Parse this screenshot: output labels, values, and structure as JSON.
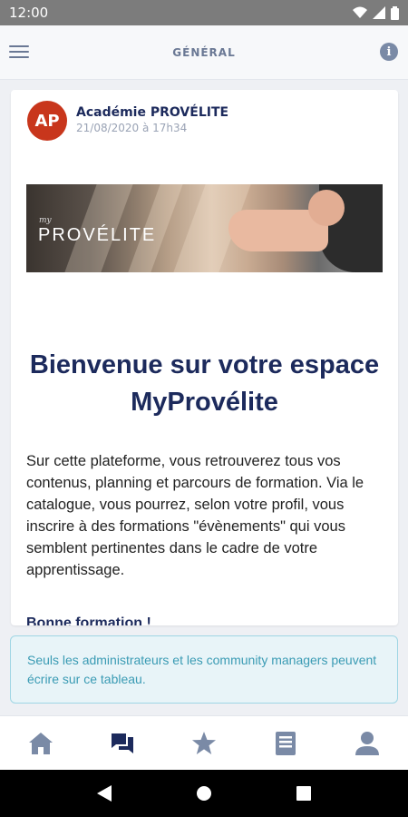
{
  "status_bar": {
    "time": "12:00"
  },
  "header": {
    "title": "GÉNÉRAL"
  },
  "post": {
    "avatar_initials": "AP",
    "author": "Académie PROVÉLITE",
    "date": "21/08/2020 à 17h34",
    "banner": {
      "logo_prefix": "my",
      "logo": "PROVÉLITE"
    },
    "headline": "Bienvenue sur votre espace MyProvélite",
    "body": "Sur cette plateforme, vous retrouverez tous vos contenus, planning et parcours de formation. Via le catalogue, vous pourrez, selon votre profil, vous inscrire à des formations \"évènements\" qui vous semblent pertinentes dans le cadre de votre apprentissage.",
    "signoff": "Bonne formation !"
  },
  "notice": {
    "text": "Seuls les administrateurs et les community managers peuvent écrire sur ce tableau."
  },
  "bottom_nav": {
    "items": [
      {
        "icon": "home-icon",
        "active": false
      },
      {
        "icon": "chat-icon",
        "active": true
      },
      {
        "icon": "star-icon",
        "active": false
      },
      {
        "icon": "book-icon",
        "active": false
      },
      {
        "icon": "profile-icon",
        "active": false
      }
    ]
  },
  "colors": {
    "primary": "#1c2a5c",
    "accent_avatar": "#c8361c",
    "nav_inactive": "#7a8aa6",
    "nav_active": "#1c2a5c",
    "notice_text": "#3a9bb4",
    "notice_bg": "#e8f4f8"
  }
}
